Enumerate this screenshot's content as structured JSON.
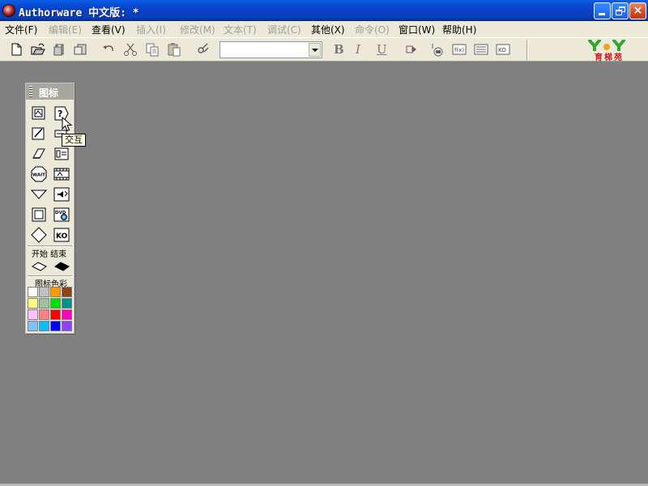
{
  "window": {
    "title": "Authorware 中文版: *",
    "minimize": "minimize",
    "maximize": "restore",
    "close": "×"
  },
  "menu": [
    {
      "label": "文件(F)",
      "enabled": true
    },
    {
      "label": "编辑(E)",
      "enabled": false
    },
    {
      "label": "查看(V)",
      "enabled": true
    },
    {
      "label": "插入(I)",
      "enabled": false
    },
    {
      "label": "修改(M)",
      "enabled": false
    },
    {
      "label": "文本(T)",
      "enabled": false
    },
    {
      "label": "调试(C)",
      "enabled": false
    },
    {
      "label": "其他(X)",
      "enabled": true
    },
    {
      "label": "命令(O)",
      "enabled": false
    },
    {
      "label": "窗口(W)",
      "enabled": true
    },
    {
      "label": "帮助(H)",
      "enabled": true
    }
  ],
  "toolbar": {
    "icons": [
      "new-file-icon",
      "open-file-icon",
      "save-all-icon",
      "import-icon",
      "undo-icon",
      "cut-icon",
      "copy-icon",
      "paste-icon",
      "find-icon"
    ],
    "font_select_value": "",
    "bold": "B",
    "italic": "I",
    "underline": "U",
    "run_icons": [
      "run-icon",
      "control-panel-icon",
      "function-window-icon",
      "variable-window-icon",
      "knowledge-object-icon"
    ],
    "logo_text": "育梯苑"
  },
  "palette": {
    "title": "图标",
    "icons": [
      [
        "display-icon",
        "interaction-icon"
      ],
      [
        "calculation-icon",
        "navigate-icon"
      ],
      [
        "erase-icon",
        "framework-icon"
      ],
      [
        "wait-icon",
        "movie-icon"
      ],
      [
        "decision-icon",
        "sound-icon"
      ],
      [
        "motion-icon",
        "dvd-video-icon"
      ],
      [
        "map-group-icon",
        "knowledge-object-icon"
      ]
    ],
    "wait_label": "WAIT",
    "dvd_label": "DVD",
    "ko_label": "KO",
    "flags_label": "开始 结束",
    "colors_label": "图标色彩",
    "swatches": [
      "#ffffff",
      "#c0c0c0",
      "#ff9900",
      "#8b4513",
      "#ffff80",
      "#a0c0a0",
      "#00e000",
      "#009090",
      "#ffc0ff",
      "#ff8080",
      "#ff0000",
      "#ff00c0",
      "#80c0ff",
      "#00c0ff",
      "#0000ff",
      "#9040ff"
    ]
  },
  "tooltip": "交互"
}
